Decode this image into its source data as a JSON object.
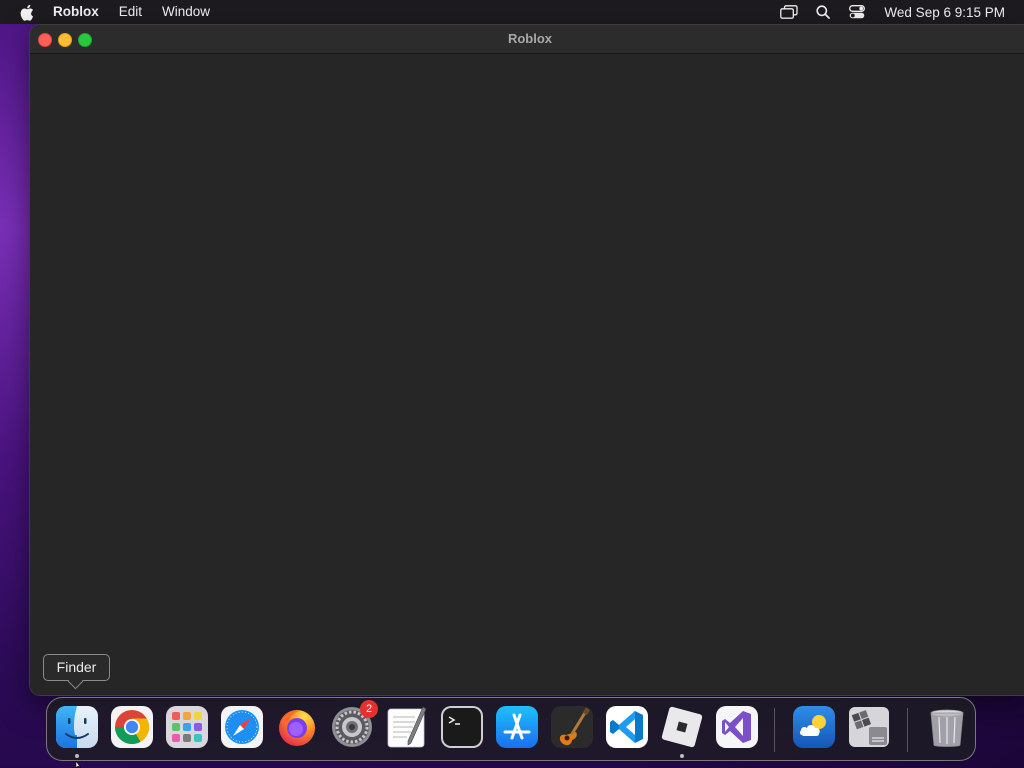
{
  "menubar": {
    "apple_icon": "apple-logo-icon",
    "app_name": "Roblox",
    "menus": [
      "Edit",
      "Window"
    ],
    "status_icons": [
      "screen-mirroring-icon",
      "spotlight-search-icon",
      "control-center-icon"
    ],
    "clock": "Wed Sep 6  9:15 PM"
  },
  "window": {
    "title": "Roblox"
  },
  "tooltip": {
    "text": "Finder"
  },
  "dock": {
    "items": [
      {
        "name": "Finder",
        "icon": "finder-icon",
        "running": true
      },
      {
        "name": "Google Chrome",
        "icon": "chrome-icon",
        "running": false
      },
      {
        "name": "Launchpad",
        "icon": "launchpad-icon",
        "running": false
      },
      {
        "name": "Safari",
        "icon": "safari-icon",
        "running": false
      },
      {
        "name": "Firefox",
        "icon": "firefox-icon",
        "running": false
      },
      {
        "name": "System Preferences",
        "icon": "system-preferences-icon",
        "running": false,
        "badge": "2"
      },
      {
        "name": "TextEdit",
        "icon": "textedit-icon",
        "running": false
      },
      {
        "name": "Terminal",
        "icon": "terminal-icon",
        "running": false
      },
      {
        "name": "App Store",
        "icon": "app-store-icon",
        "running": false
      },
      {
        "name": "GarageBand",
        "icon": "garageband-icon",
        "running": false
      },
      {
        "name": "Visual Studio Code",
        "icon": "vscode-icon",
        "running": false
      },
      {
        "name": "Roblox",
        "icon": "roblox-icon",
        "running": true
      },
      {
        "name": "Visual Studio",
        "icon": "visual-studio-icon",
        "running": false
      },
      {
        "name": "Weather",
        "icon": "weather-icon",
        "running": false
      },
      {
        "name": "Boot Camp Assistant",
        "icon": "bootcamp-icon",
        "running": false
      },
      {
        "name": "Trash",
        "icon": "trash-icon",
        "running": false
      }
    ]
  },
  "colors": {
    "menubar_bg": "#1d1b1f",
    "window_bg": "#262626",
    "close": "#fe5f57",
    "minimize": "#febc2e",
    "maximize": "#28c840",
    "badge": "#e5312b"
  }
}
